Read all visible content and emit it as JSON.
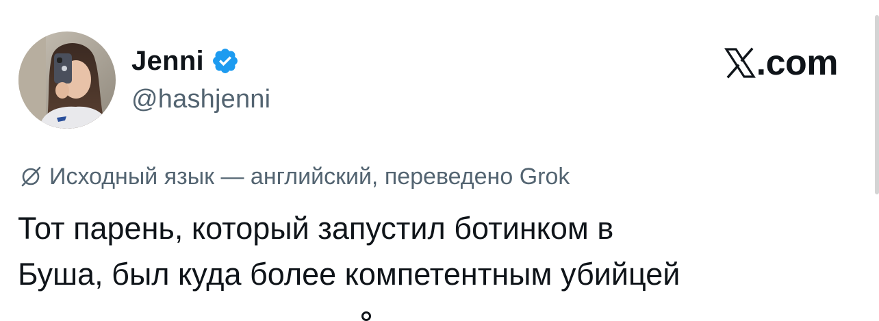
{
  "author": {
    "display_name": "Jenni",
    "handle": "@hashjenni",
    "verified": true,
    "avatar_icon": "profile-photo-avatar",
    "badge_icon": "verified-check-icon"
  },
  "brand": {
    "logo_text": ".com",
    "logo_icon": "x-logo-icon"
  },
  "translation": {
    "icon": "translate-icon",
    "note": "Исходный язык — английский, переведено Grok"
  },
  "tweet": {
    "line1": "Тот парень, который запустил ботинком в",
    "line2": "Буша, был куда более компетентным убийцей"
  },
  "colors": {
    "text_primary": "#0f1419",
    "text_secondary": "#536471",
    "verified_blue": "#1d9bf0",
    "background": "#ffffff"
  }
}
